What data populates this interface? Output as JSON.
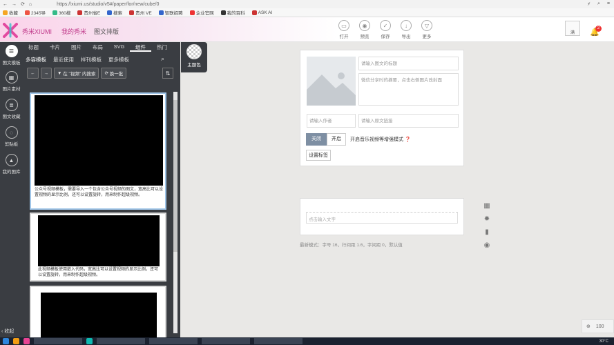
{
  "browser": {
    "url": "https://xiumi.us/studio/v5#/paper/for/new/cube/0",
    "bookmarks": [
      "收藏",
      "2345导",
      "360搜",
      "贵州省E",
      "搜索",
      "贵州 VE",
      "智联招聘",
      "企业官网",
      "我的百科",
      "ASK AI"
    ]
  },
  "header": {
    "brand": "秀米XIUMI",
    "nav": [
      "我的秀米",
      "图文排版"
    ],
    "tools": [
      {
        "label": "打开",
        "icon": "folder-icon"
      },
      {
        "label": "预览",
        "icon": "eye-icon"
      },
      {
        "label": "保存",
        "icon": "save-icon"
      },
      {
        "label": "导出",
        "icon": "export-icon"
      },
      {
        "label": "更多",
        "icon": "more-icon"
      }
    ],
    "avatar_text": "满",
    "notification_count": "2"
  },
  "rail": {
    "items": [
      "图文模板",
      "图片素材",
      "图文收藏",
      "剪贴板",
      "我的图库"
    ],
    "collapse_label": "收起"
  },
  "panel": {
    "tabs": [
      "标题",
      "卡片",
      "图片",
      "布局",
      "SVG",
      "组件",
      "热门"
    ],
    "active_tab": "组件",
    "subtabs": [
      "多容模板",
      "最近使用",
      "样刊模板",
      "更多模板"
    ],
    "active_subtab": "多容模板",
    "filter_label": "在 \"视频\" 内搜索",
    "swap_label": "换一批",
    "cards": [
      {
        "caption": "公众号视频模板，需要导入一个包含公众号视频的图文，宽高比可以设置视频的显示比例，还可以设置旋转，用来制作超级视频。"
      },
      {
        "caption": "此视频模板使用嵌入代码，宽高比可以设置视频的显示比例，还可以设置旋转，用来制作超级视频。"
      },
      {
        "caption": ""
      }
    ]
  },
  "theme": {
    "label": "主题色"
  },
  "editor": {
    "title_placeholder": "请输入图文的标题",
    "summary_placeholder": "微信分享时的摘要，点击右侧图片改封面",
    "author_placeholder": "请输入作者",
    "link_placeholder": "请输入原文链接",
    "switch_off": "关闭",
    "switch_on": "开启",
    "switch_desc": "开启音乐视频等增强模式",
    "set_tag": "设置标签",
    "content_placeholder": "点击输入文字",
    "status": "最新模式：字号 16，行间距 1.6，字间距 0，默认值"
  },
  "zoom": {
    "value": "100"
  },
  "taskbar": {
    "temperature": "30°C"
  },
  "colors": {
    "accent": "#c0398a",
    "panel_bg": "#3a3d42",
    "editor_bg": "#e9e8e6"
  }
}
